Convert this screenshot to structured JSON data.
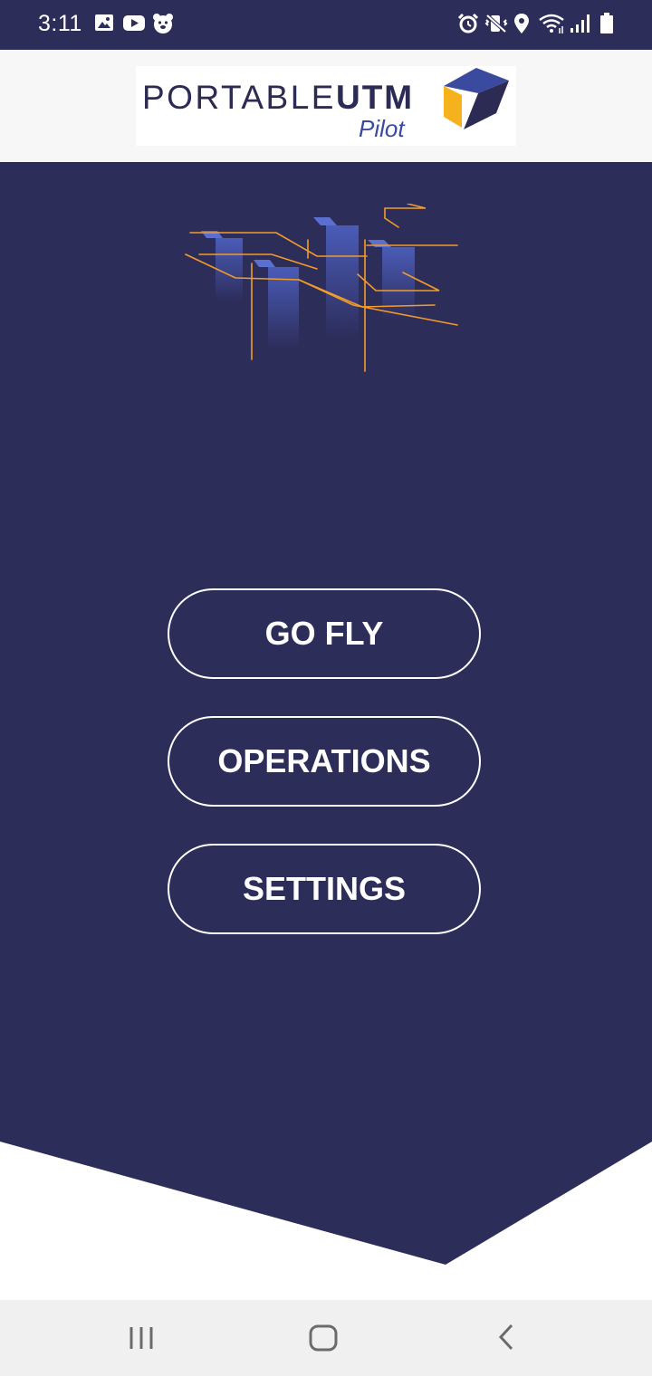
{
  "status_bar": {
    "time": "3:11",
    "left_icons": [
      "gallery-icon",
      "youtube-icon",
      "bear-app-icon"
    ],
    "right_icons": [
      "alarm-icon",
      "mute-vibrate-icon",
      "location-icon",
      "wifi-icon",
      "signal-icon",
      "battery-icon"
    ]
  },
  "header": {
    "logo_text_light": "PORTABLE",
    "logo_text_bold": "UTM",
    "logo_subtitle": "Pilot"
  },
  "menu": {
    "buttons": [
      {
        "label": "GO FLY"
      },
      {
        "label": "OPERATIONS"
      },
      {
        "label": "SETTINGS"
      }
    ]
  },
  "nav_bar": {
    "buttons": [
      "recent-apps-icon",
      "home-icon",
      "back-icon"
    ]
  },
  "colors": {
    "primary_navy": "#2d2d5a",
    "accent_orange": "#f39c2a",
    "logo_blue": "#3a4a9f",
    "logo_yellow": "#f5b21d"
  }
}
